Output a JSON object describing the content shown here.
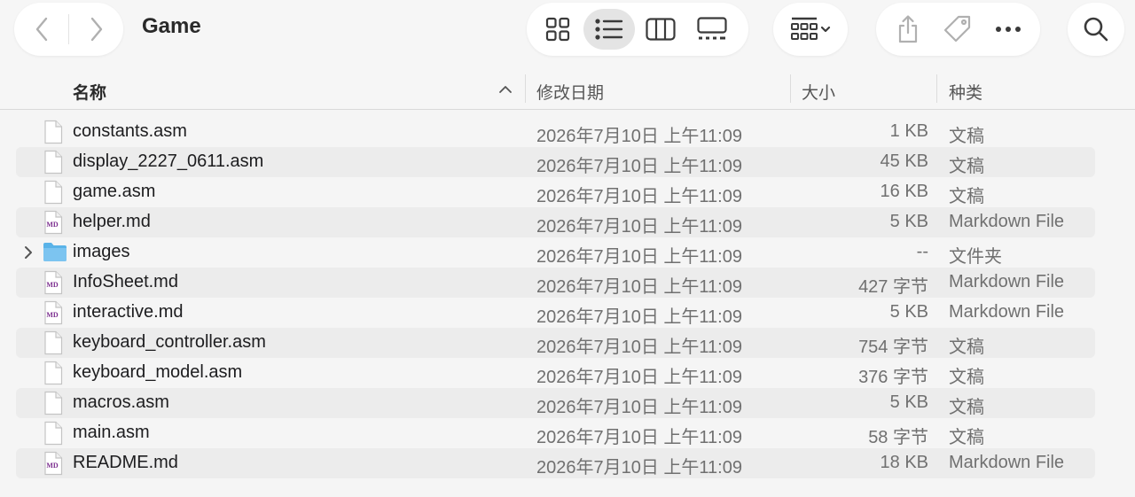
{
  "window": {
    "title": "Game"
  },
  "toolbar": {
    "nav": {
      "back_icon": "chevron-left-icon",
      "forward_icon": "chevron-right-icon"
    },
    "views": [
      {
        "name": "icon-view",
        "icon": "grid-icon",
        "active": false
      },
      {
        "name": "list-view",
        "icon": "list-icon",
        "active": true
      },
      {
        "name": "column-view",
        "icon": "columns-icon",
        "active": false
      },
      {
        "name": "gallery-view",
        "icon": "gallery-icon",
        "active": false
      }
    ],
    "group_icon": "group-icon",
    "share_icon": "share-icon",
    "tag_icon": "tag-icon",
    "more_icon": "ellipsis-icon",
    "search_icon": "search-icon"
  },
  "columns": {
    "name": "名称",
    "date": "修改日期",
    "size": "大小",
    "kind": "种类"
  },
  "files": [
    {
      "name": "constants.asm",
      "date": "2026年7月10日 上午11:09",
      "size": "1 KB",
      "kind": "文稿",
      "icon": "document-icon",
      "folder": false
    },
    {
      "name": "display_2227_0611.asm",
      "date": "2026年7月10日 上午11:09",
      "size": "45 KB",
      "kind": "文稿",
      "icon": "document-icon",
      "folder": false
    },
    {
      "name": "game.asm",
      "date": "2026年7月10日 上午11:09",
      "size": "16 KB",
      "kind": "文稿",
      "icon": "document-icon",
      "folder": false
    },
    {
      "name": "helper.md",
      "date": "2026年7月10日 上午11:09",
      "size": "5 KB",
      "kind": "Markdown File",
      "icon": "markdown-icon",
      "folder": false
    },
    {
      "name": "images",
      "date": "2026年7月10日 上午11:09",
      "size": "--",
      "kind": "文件夹",
      "icon": "folder-icon",
      "folder": true
    },
    {
      "name": "InfoSheet.md",
      "date": "2026年7月10日 上午11:09",
      "size": "427 字节",
      "kind": "Markdown File",
      "icon": "markdown-icon",
      "folder": false
    },
    {
      "name": "interactive.md",
      "date": "2026年7月10日 上午11:09",
      "size": "5 KB",
      "kind": "Markdown File",
      "icon": "markdown-icon",
      "folder": false
    },
    {
      "name": "keyboard_controller.asm",
      "date": "2026年7月10日 上午11:09",
      "size": "754 字节",
      "kind": "文稿",
      "icon": "document-icon",
      "folder": false
    },
    {
      "name": "keyboard_model.asm",
      "date": "2026年7月10日 上午11:09",
      "size": "376 字节",
      "kind": "文稿",
      "icon": "document-icon",
      "folder": false
    },
    {
      "name": "macros.asm",
      "date": "2026年7月10日 上午11:09",
      "size": "5 KB",
      "kind": "文稿",
      "icon": "document-icon",
      "folder": false
    },
    {
      "name": "main.asm",
      "date": "2026年7月10日 上午11:09",
      "size": "58 字节",
      "kind": "文稿",
      "icon": "document-icon",
      "folder": false
    },
    {
      "name": "README.md",
      "date": "2026年7月10日 上午11:09",
      "size": "18 KB",
      "kind": "Markdown File",
      "icon": "markdown-icon",
      "folder": false
    }
  ],
  "markdown_badge": "MD",
  "colors": {
    "folder": "#5ab3e8",
    "markdown_badge": "#7b2d8e",
    "selected_view_bg": "#e4e4e4",
    "stripe": "#ececec"
  }
}
